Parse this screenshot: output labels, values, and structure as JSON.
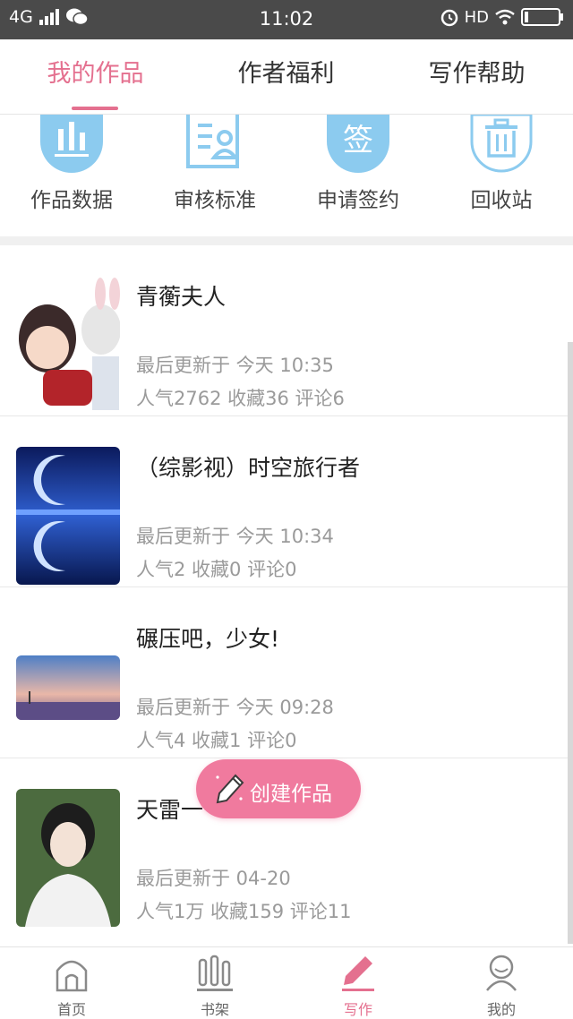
{
  "status_bar": {
    "network": "4G",
    "time": "11:02",
    "hd": "HD"
  },
  "tabs": [
    {
      "label": "我的作品",
      "active": true
    },
    {
      "label": "作者福利",
      "active": false
    },
    {
      "label": "写作帮助",
      "active": false
    }
  ],
  "actions": [
    {
      "label": "作品数据",
      "icon": "bar-chart-icon"
    },
    {
      "label": "审核标准",
      "icon": "document-person-icon"
    },
    {
      "label": "申请签约",
      "icon": "sign-icon",
      "icon_text": "签"
    },
    {
      "label": "回收站",
      "icon": "trash-icon"
    }
  ],
  "works": [
    {
      "title": "青蘅夫人",
      "updated": "最后更新于 今天 10:35",
      "stats": "人气2762 收藏36 评论6"
    },
    {
      "title": "（综影视）时空旅行者",
      "updated": "最后更新于 今天 10:34",
      "stats": "人气2 收藏0 评论0"
    },
    {
      "title": "碾压吧，少女!",
      "updated": "最后更新于 今天 09:28",
      "stats": "人气4 收藏1 评论0"
    },
    {
      "title": "天雷一",
      "updated": "最后更新于 04-20",
      "stats": "人气1万 收藏159 评论11"
    }
  ],
  "fab": {
    "label": "创建作品",
    "icon": "pencil-icon"
  },
  "bottom_nav": [
    {
      "label": "首页",
      "icon": "home-icon",
      "active": false
    },
    {
      "label": "书架",
      "icon": "bookshelf-icon",
      "active": false
    },
    {
      "label": "写作",
      "icon": "pencil-icon",
      "active": true
    },
    {
      "label": "我的",
      "icon": "profile-icon",
      "active": false
    }
  ],
  "colors": {
    "accent": "#e4708f",
    "fab": "#f07a9e",
    "icon_blue": "#8ccbef",
    "status_bar": "#4a4a4a"
  }
}
